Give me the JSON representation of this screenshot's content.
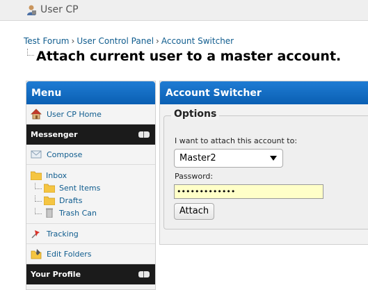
{
  "topbar": {
    "title": "User CP"
  },
  "breadcrumb": {
    "items": [
      "Test Forum",
      "User Control Panel",
      "Account Switcher"
    ],
    "separator": "›"
  },
  "page_title": "Attach current user to a master account.",
  "menu": {
    "title": "Menu",
    "home_label": "User CP Home",
    "messenger_label": "Messenger",
    "compose_label": "Compose",
    "inbox_label": "Inbox",
    "sent_label": "Sent Items",
    "drafts_label": "Drafts",
    "trash_label": "Trash Can",
    "tracking_label": "Tracking",
    "edit_folders_label": "Edit Folders",
    "profile_label": "Your Profile"
  },
  "panel": {
    "title": "Account Switcher",
    "legend": "Options",
    "attach_label": "I want to attach this account to:",
    "selected_account": "Master2",
    "password_label": "Password:",
    "password_value": "•••••••••••••",
    "button_label": "Attach"
  },
  "colors": {
    "header_blue": "#0a5fb3",
    "link": "#0f5c8e",
    "dark_section": "#1b1b1b",
    "password_bg": "#ffffc8"
  }
}
